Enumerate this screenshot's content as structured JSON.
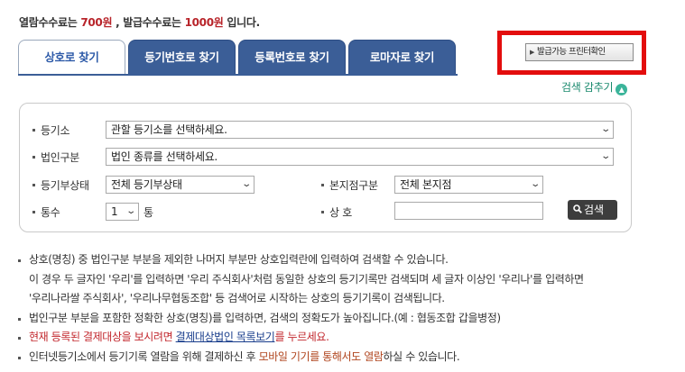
{
  "fee": {
    "prefix": "열람수수료는 ",
    "view_fee": "700원",
    "middle": " , 발급수수료는 ",
    "issue_fee": "1000원",
    "suffix": " 입니다."
  },
  "tabs": [
    {
      "label": "상호로 찾기"
    },
    {
      "label": "등기번호로 찾기"
    },
    {
      "label": "등록번호로 찾기"
    },
    {
      "label": "로마자로 찾기"
    }
  ],
  "print_button": "발급가능 프린터확인",
  "collapse_link": "검색 감추기",
  "form": {
    "registry_label": "등기소",
    "registry_value": "관할 등기소를 선택하세요.",
    "corp_type_label": "법인구분",
    "corp_type_value": "법인 종류를 선택하세요.",
    "reg_status_label": "등기부상태",
    "reg_status_value": "전체 등기부상태",
    "branch_label": "본지점구분",
    "branch_value": "전체 본지점",
    "copies_label": "통수",
    "copies_value": "1",
    "copies_unit": "통",
    "name_label": "상 호",
    "name_value": "",
    "search_button": "검색"
  },
  "notes": {
    "n1": "상호(명칭) 중 법인구분 부분을 제외한 나머지 부분만 상호입력란에 입력하여 검색할 수 있습니다.",
    "n1b": "이 경우 두 글자인 '우리'를 입력하면 '우리 주식회사'처럼 동일한 상호의 등기기록만 검색되며 세 글자 이상인 '우리나'를 입력하면",
    "n1c": "'우리나라쌀 주식회사', '우리나무협동조합' 등 검색어로 시작하는 상호의 등기기록이 검색됩니다.",
    "n2": "법인구분 부분을 포함한 정확한 상호(명칭)를 입력하면, 검색의 정확도가 높아집니다.(예 : 협동조합 갑을병정)",
    "n3_pre": "현재 등록된 결제대상을 보시려면 ",
    "n3_link": "결제대상법인 목록보기",
    "n3_post": "를 누르세요.",
    "n4_pre": "인터넷등기소에서 등기기록 열람을 위해 결제하신 후 ",
    "n4_hl": "모바일 기기를 통해서도 열람",
    "n4_post": "하실 수 있습니다."
  },
  "colors": {
    "tab_blue": "#3b5e97",
    "fee_red": "#b8242a",
    "highlight_box": "#e30d0d",
    "collapse_green": "#1b8a6e"
  }
}
